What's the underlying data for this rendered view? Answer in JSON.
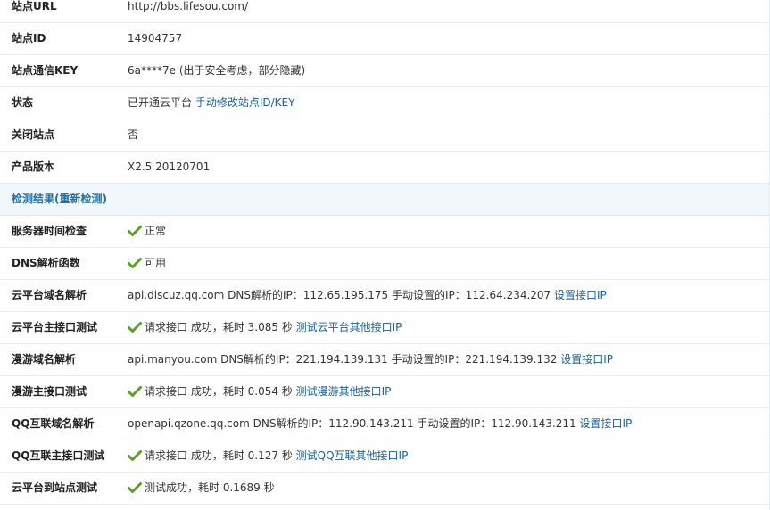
{
  "site_info": {
    "url": {
      "label": "站点URL",
      "value": "http://bbs.lifesou.com/"
    },
    "id": {
      "label": "站点ID",
      "value": "14904757"
    },
    "key": {
      "label": "站点通信KEY",
      "value": "6a****7e (出于安全考虑，部分隐藏)"
    },
    "status": {
      "label": "状态",
      "value": "已开通云平台",
      "link": "手动修改站点ID/KEY"
    },
    "closed": {
      "label": "关闭站点",
      "value": "否"
    },
    "version": {
      "label": "产品版本",
      "value": "X2.5 20120701"
    }
  },
  "section": {
    "title": "检测结果(重新检测)"
  },
  "checks": {
    "server_time": {
      "label": "服务器时间检查",
      "value": "正常"
    },
    "dns_func": {
      "label": "DNS解析函数",
      "value": "可用"
    },
    "cloud_dns": {
      "label": "云平台域名解析",
      "value": "api.discuz.qq.com DNS解析的IP：112.65.195.175 手动设置的IP：112.64.234.207",
      "link": "设置接口IP"
    },
    "cloud_api": {
      "label": "云平台主接口测试",
      "value": "请求接口 成功，耗时 3.085 秒",
      "link": "测试云平台其他接口IP"
    },
    "manyou_dns": {
      "label": "漫游域名解析",
      "value": "api.manyou.com DNS解析的IP：221.194.139.131 手动设置的IP：221.194.139.132",
      "link": "设置接口IP"
    },
    "manyou_api": {
      "label": "漫游主接口测试",
      "value": "请求接口 成功，耗时 0.054 秒",
      "link": "测试漫游其他接口IP"
    },
    "qq_dns": {
      "label": "QQ互联域名解析",
      "value": "openapi.qzone.qq.com DNS解析的IP：112.90.143.211 手动设置的IP：112.90.143.211",
      "link": "设置接口IP"
    },
    "qq_api": {
      "label": "QQ互联主接口测试",
      "value": "请求接口 成功，耗时 0.127 秒",
      "link": "测试QQ互联其他接口IP"
    },
    "cloud_site": {
      "label": "云平台到站点测试",
      "value": "测试成功，耗时 0.1689 秒"
    }
  },
  "colors": {
    "check_green": "#5aa028",
    "link_blue": "#1a5f99",
    "section_bg": "#f2f7fc"
  }
}
